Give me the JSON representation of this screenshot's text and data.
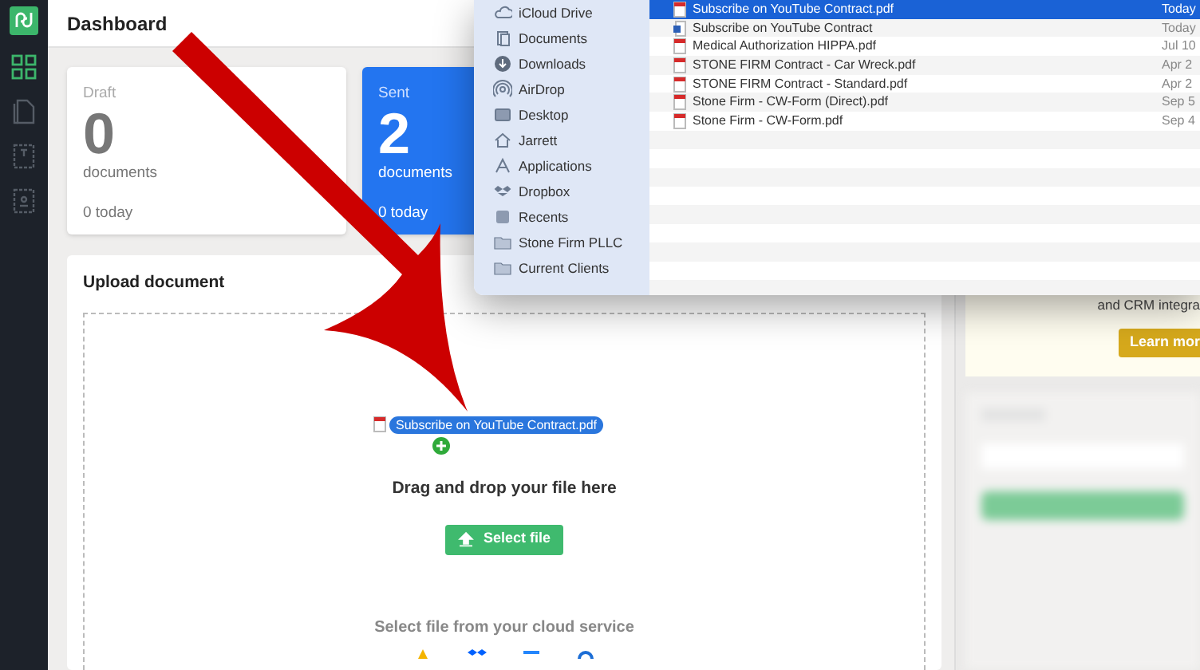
{
  "header": {
    "title": "Dashboard"
  },
  "stat_cards": [
    {
      "label": "Draft",
      "count": "0",
      "unit": "documents",
      "today": "0 today",
      "kind": "draft"
    },
    {
      "label": "Sent",
      "count": "2",
      "unit": "documents",
      "today": "0 today",
      "kind": "sent"
    }
  ],
  "upload": {
    "title": "Upload document",
    "dragged_file": "Subscribe on YouTube Contract.pdf",
    "prompt": "Drag and drop your file here",
    "button": "Select file",
    "cloud_label": "Select file from your cloud service"
  },
  "promo": {
    "text": "and CRM integra",
    "button": "Learn mor"
  },
  "file_dialog": {
    "sidebar": [
      {
        "label": "iCloud Drive",
        "kind": "cloud"
      },
      {
        "label": "Documents",
        "kind": "docs"
      },
      {
        "label": "Downloads",
        "kind": "download"
      },
      {
        "label": "AirDrop",
        "kind": "airdrop"
      },
      {
        "label": "Desktop",
        "kind": "desktop"
      },
      {
        "label": "Jarrett",
        "kind": "home"
      },
      {
        "label": "Applications",
        "kind": "apps"
      },
      {
        "label": "Dropbox",
        "kind": "dropbox"
      },
      {
        "label": "Recents",
        "kind": "recents"
      },
      {
        "label": "Stone Firm PLLC",
        "kind": "folder"
      },
      {
        "label": "Current Clients",
        "kind": "folder"
      }
    ],
    "files": [
      {
        "name": "Subscribe on YouTube Contract.pdf",
        "date": "Today",
        "kind": "pdf",
        "selected": true
      },
      {
        "name": "Subscribe on YouTube Contract",
        "date": "Today",
        "kind": "doc",
        "selected": false
      },
      {
        "name": "Medical Authorization HIPPA.pdf",
        "date": "Jul 10",
        "kind": "pdf",
        "selected": false
      },
      {
        "name": "STONE FIRM Contract - Car Wreck.pdf",
        "date": "Apr 2",
        "kind": "pdf",
        "selected": false
      },
      {
        "name": "STONE FIRM Contract - Standard.pdf",
        "date": "Apr 2",
        "kind": "pdf",
        "selected": false
      },
      {
        "name": "Stone Firm - CW-Form (Direct).pdf",
        "date": "Sep 5",
        "kind": "pdf",
        "selected": false
      },
      {
        "name": "Stone Firm - CW-Form.pdf",
        "date": "Sep 4",
        "kind": "pdf",
        "selected": false
      }
    ]
  }
}
